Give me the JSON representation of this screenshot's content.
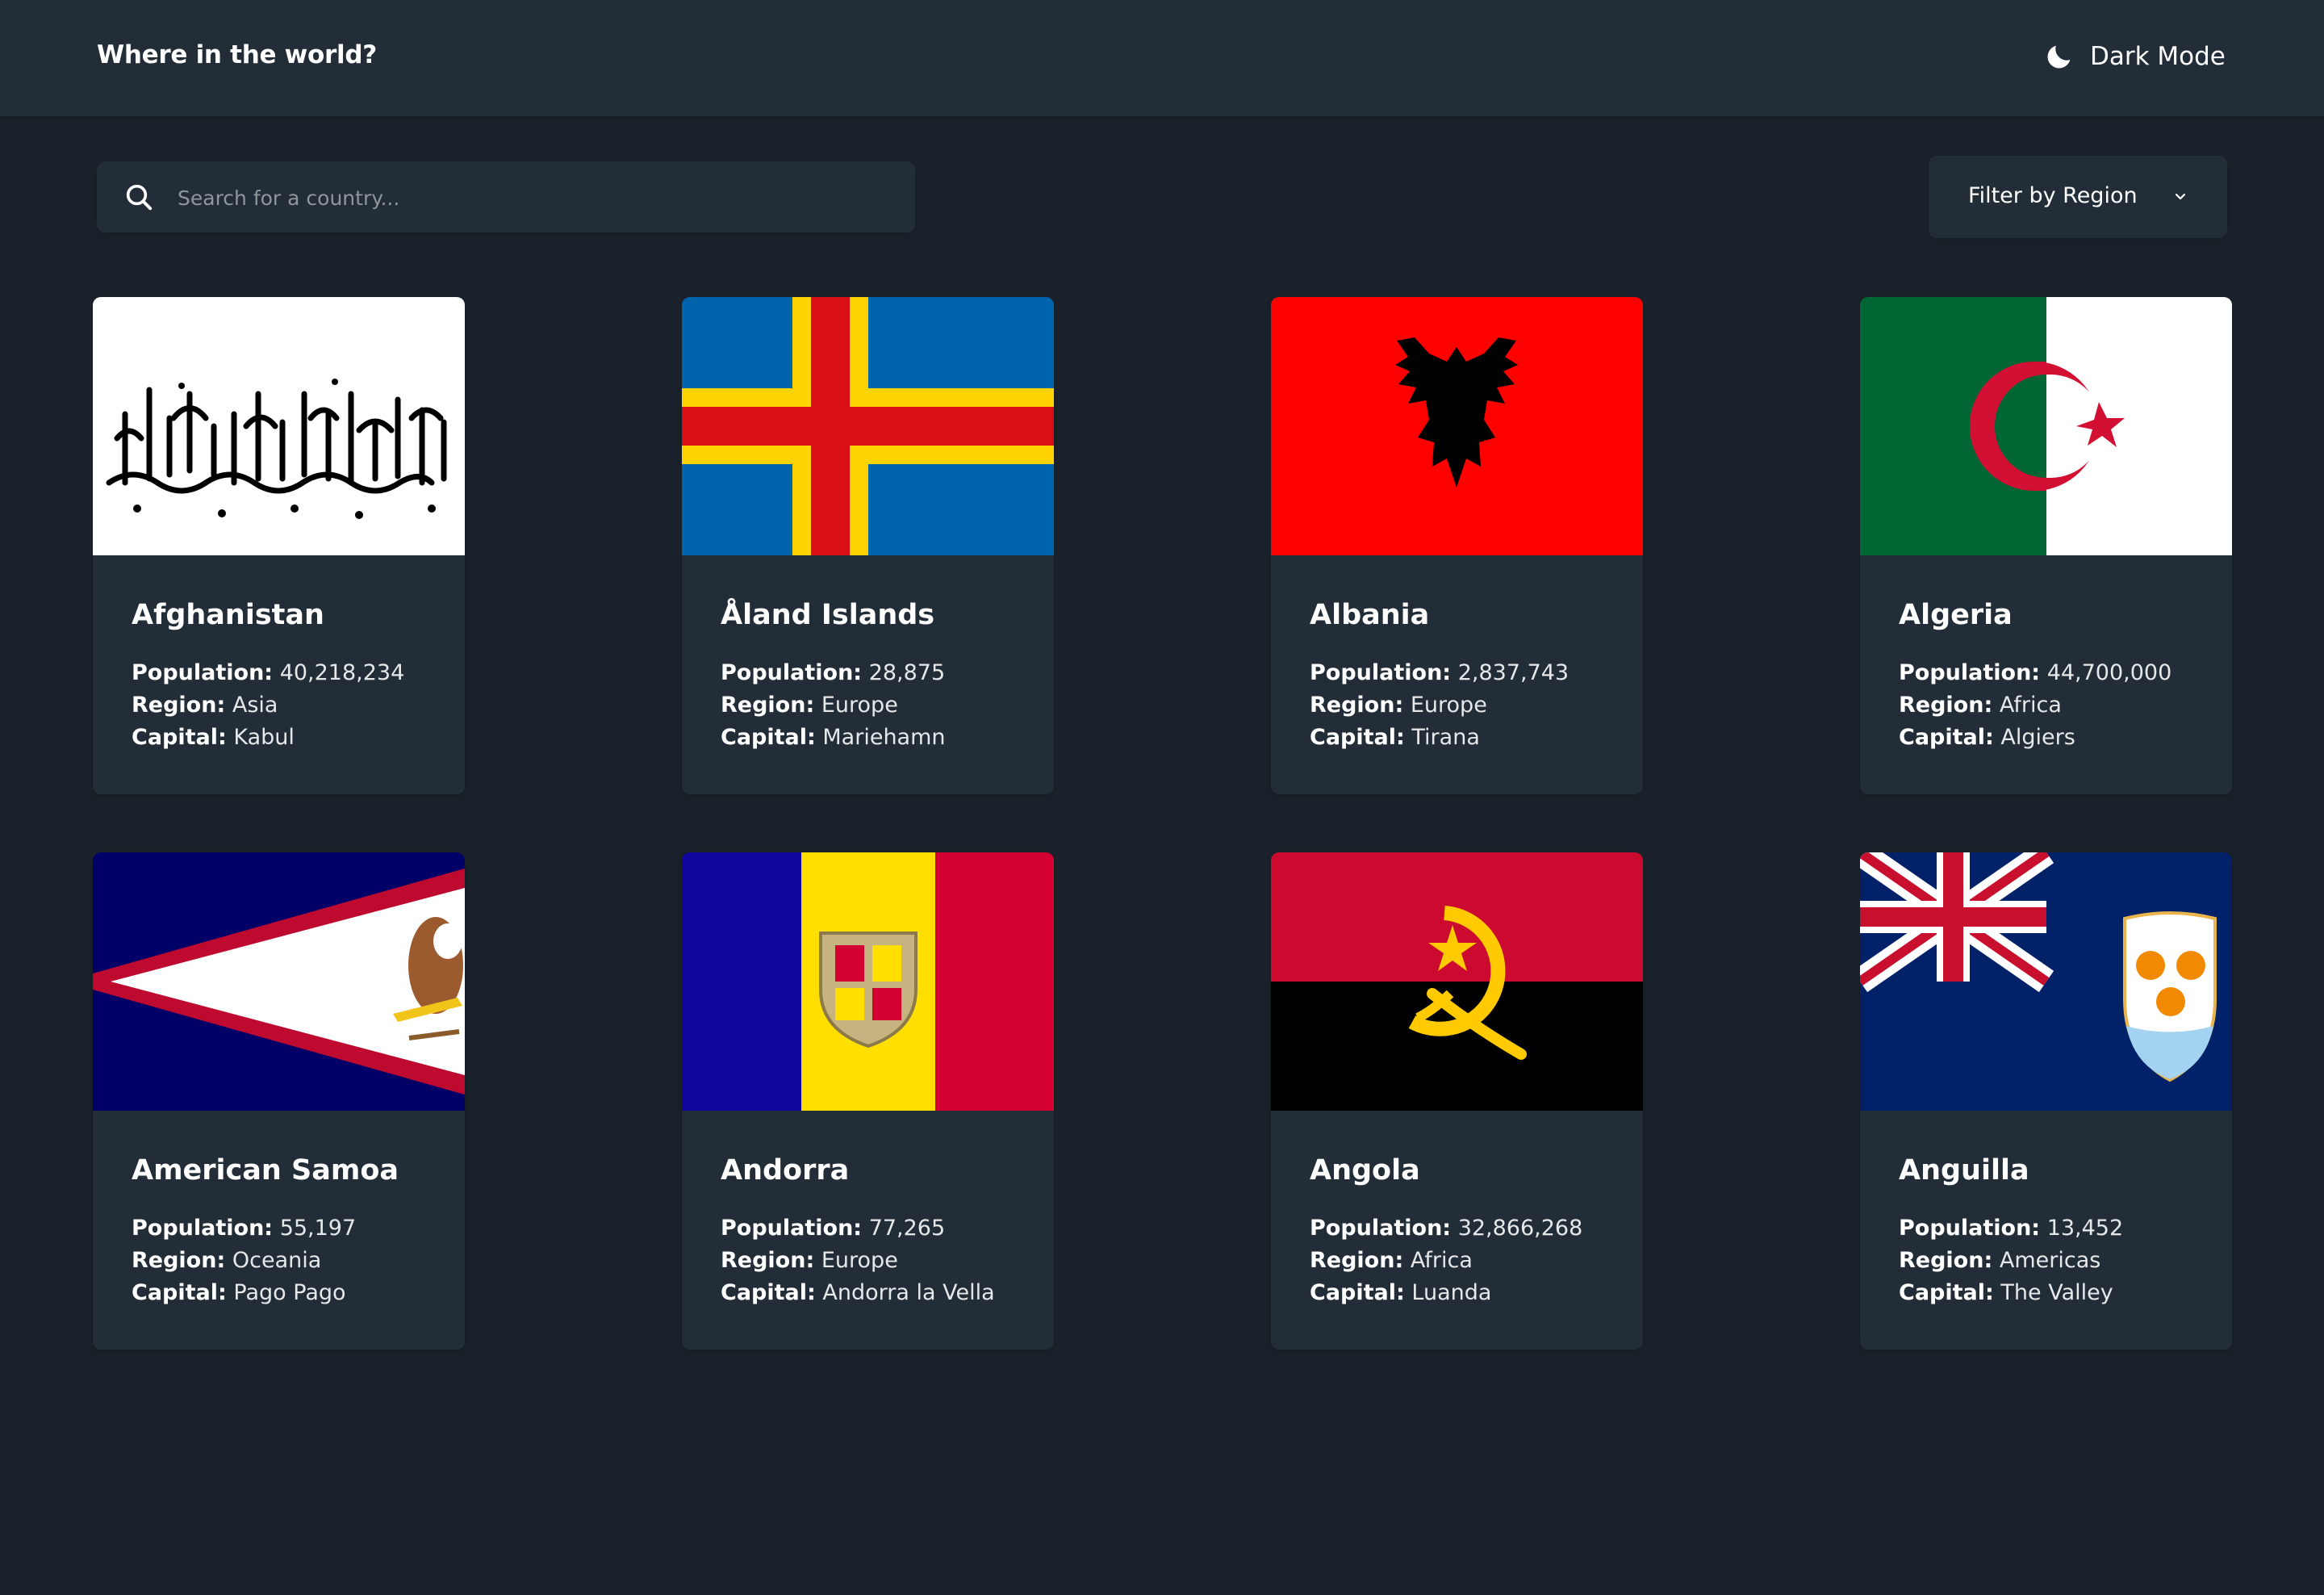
{
  "header": {
    "title": "Where in the world?",
    "dark_mode_label": "Dark Mode",
    "dark_mode_icon": "moon-icon"
  },
  "search": {
    "placeholder": "Search for a country...",
    "value": "",
    "icon": "search-icon"
  },
  "filter": {
    "label": "Filter by Region",
    "icon": "chevron-down-icon"
  },
  "labels": {
    "population": "Population:",
    "region": "Region:",
    "capital": "Capital:"
  },
  "countries": [
    {
      "name": "Afghanistan",
      "population": "40,218,234",
      "region": "Asia",
      "capital": "Kabul"
    },
    {
      "name": "Åland Islands",
      "population": "28,875",
      "region": "Europe",
      "capital": "Mariehamn"
    },
    {
      "name": "Albania",
      "population": "2,837,743",
      "region": "Europe",
      "capital": "Tirana"
    },
    {
      "name": "Algeria",
      "population": "44,700,000",
      "region": "Africa",
      "capital": "Algiers"
    },
    {
      "name": "American Samoa",
      "population": "55,197",
      "region": "Oceania",
      "capital": "Pago Pago"
    },
    {
      "name": "Andorra",
      "population": "77,265",
      "region": "Europe",
      "capital": "Andorra la Vella"
    },
    {
      "name": "Angola",
      "population": "32,866,268",
      "region": "Africa",
      "capital": "Luanda"
    },
    {
      "name": "Anguilla",
      "population": "13,452",
      "region": "Americas",
      "capital": "The Valley"
    }
  ],
  "colors": {
    "background": "#1b222b",
    "surface": "#222d37",
    "text": "#ffffff",
    "placeholder": "#8f969c"
  }
}
